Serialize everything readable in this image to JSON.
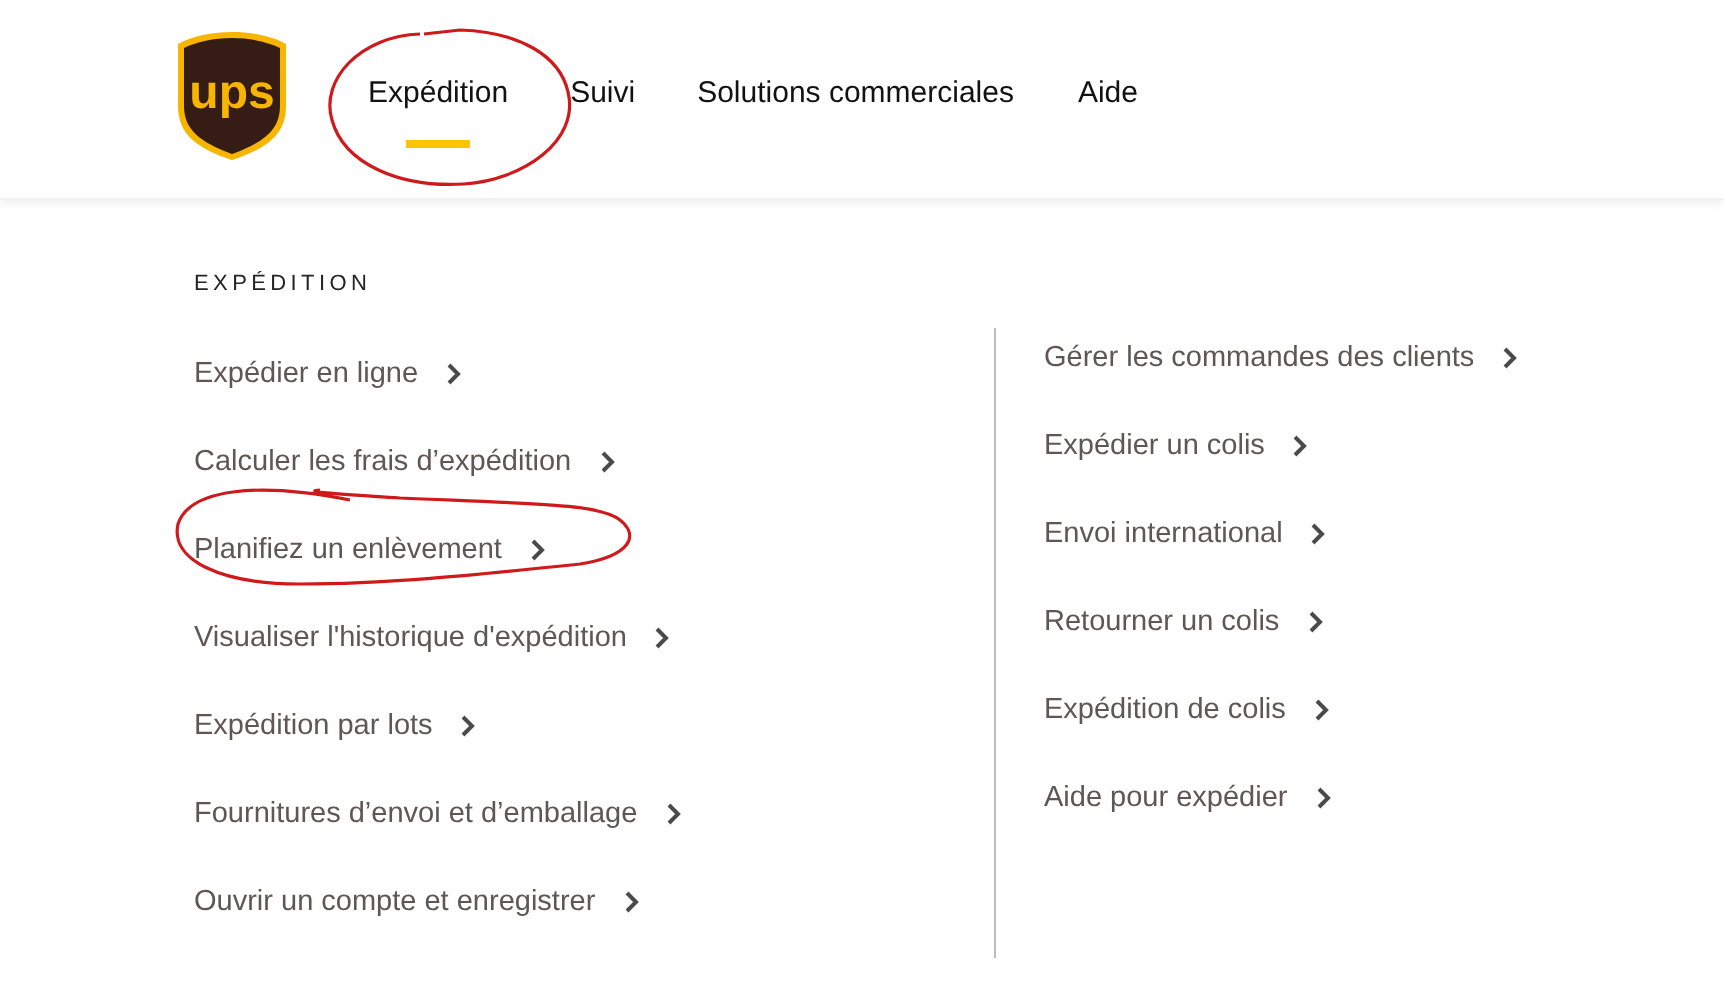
{
  "logo": {
    "text": "ups"
  },
  "nav": [
    {
      "label": "Expédition",
      "selected": true
    },
    {
      "label": "Suivi",
      "selected": false
    },
    {
      "label": "Solutions commerciales",
      "selected": false
    },
    {
      "label": "Aide",
      "selected": false
    }
  ],
  "menu": {
    "heading": "EXPÉDITION",
    "columns": [
      [
        "Expédier en ligne",
        "Calculer les frais d’expédition",
        "Planifiez un enlèvement",
        "Visualiser l'historique d'expédition",
        "Expédition par lots",
        "Fournitures d’envoi et d’emballage",
        "Ouvrir un compte et enregistrer"
      ],
      [
        "Gérer les commandes des clients",
        "Expédier un colis",
        "Envoi international",
        "Retourner un colis",
        "Expédition de colis",
        "Aide pour expédier"
      ]
    ]
  }
}
